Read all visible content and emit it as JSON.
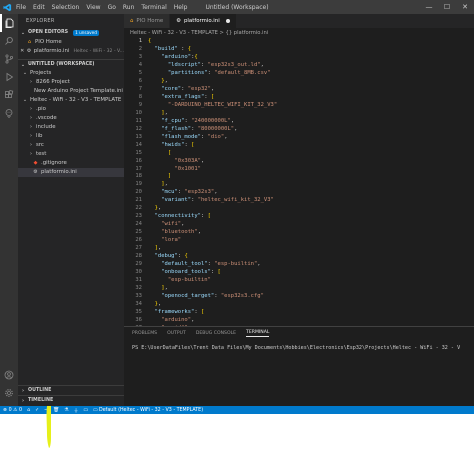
{
  "titlebar": {
    "menu": [
      "File",
      "Edit",
      "Selection",
      "View",
      "Go",
      "Run",
      "Terminal",
      "Help"
    ],
    "window_title": "Untitled (Workspace)",
    "minimize": "—",
    "maximize": "☐",
    "close": "✕"
  },
  "sidebar": {
    "title": "EXPLORER",
    "open_editors": {
      "label": "OPEN EDITORS",
      "badge": "1 unsaved",
      "items": [
        {
          "name": "PIO Home"
        },
        {
          "name": "platformio.ini",
          "detail": "Heltec - WiFi - 32 - V..."
        }
      ]
    },
    "workspace": {
      "label": "UNTITLED (WORKSPACE)",
      "folders": [
        {
          "name": "Projects"
        },
        {
          "name": "8266 Project"
        },
        {
          "name": "New Arduino Project Template.ini"
        }
      ],
      "project": {
        "name": "Heltec - WiFi - 32 - V3 - TEMPLATE",
        "children": [
          ".pio",
          ".vscode",
          "include",
          "lib",
          "src",
          "test",
          ".gitignore",
          "platformio.ini"
        ]
      }
    },
    "outline": "OUTLINE",
    "timeline": "TIMELINE"
  },
  "editor": {
    "tabs": [
      {
        "label": "PIO Home"
      },
      {
        "label": "platformio.ini"
      }
    ],
    "breadcrumb": "Heltec - WiFi - 32 - V3 - TEMPLATE > {} platformio.ini",
    "lines": [
      {
        "n": "1",
        "text": "{"
      },
      {
        "n": "2",
        "text": "  \"build\" : {"
      },
      {
        "n": "3",
        "text": "    \"arduino\":{"
      },
      {
        "n": "4",
        "text": "      \"ldscript\": \"esp32s3_out.ld\","
      },
      {
        "n": "5",
        "text": "      \"partitions\": \"default_8MB.csv\""
      },
      {
        "n": "6",
        "text": "    },"
      },
      {
        "n": "7",
        "text": "    \"core\": \"esp32\","
      },
      {
        "n": "8",
        "text": "    \"extra_flags\": ["
      },
      {
        "n": "9",
        "text": "      \"-DARDUINO_HELTEC_WIFI_KIT_32_V3\""
      },
      {
        "n": "10",
        "text": "    ],"
      },
      {
        "n": "11",
        "text": "    \"f_cpu\": \"240000000L\","
      },
      {
        "n": "12",
        "text": "    \"f_flash\": \"80000000L\","
      },
      {
        "n": "13",
        "text": "    \"flash_mode\": \"dio\","
      },
      {
        "n": "14",
        "text": "    \"hwids\": ["
      },
      {
        "n": "15",
        "text": "      ["
      },
      {
        "n": "16",
        "text": "        \"0x303A\","
      },
      {
        "n": "17",
        "text": "        \"0x1001\""
      },
      {
        "n": "18",
        "text": "      ]"
      },
      {
        "n": "19",
        "text": "    ],"
      },
      {
        "n": "20",
        "text": "    \"mcu\": \"esp32s3\","
      },
      {
        "n": "21",
        "text": "    \"variant\": \"heltec_wifi_kit_32_V3\""
      },
      {
        "n": "22",
        "text": "  },"
      },
      {
        "n": "23",
        "text": "  \"connectivity\": ["
      },
      {
        "n": "24",
        "text": "    \"wifi\","
      },
      {
        "n": "25",
        "text": "    \"bluetooth\","
      },
      {
        "n": "26",
        "text": "    \"lora\""
      },
      {
        "n": "27",
        "text": "  ],"
      },
      {
        "n": "28",
        "text": "  \"debug\": {"
      },
      {
        "n": "29",
        "text": "    \"default_tool\": \"esp-builtin\","
      },
      {
        "n": "30",
        "text": "    \"onboard_tools\": ["
      },
      {
        "n": "31",
        "text": "      \"esp-builtin\""
      },
      {
        "n": "32",
        "text": "    ],"
      },
      {
        "n": "33",
        "text": "    \"openocd_target\": \"esp32s3.cfg\""
      },
      {
        "n": "34",
        "text": "  },"
      },
      {
        "n": "35",
        "text": "  \"frameworks\": ["
      },
      {
        "n": "36",
        "text": "    \"arduino\","
      },
      {
        "n": "37",
        "text": "    \"espidf\""
      }
    ]
  },
  "panel": {
    "tabs": [
      "PROBLEMS",
      "OUTPUT",
      "DEBUG CONSOLE",
      "TERMINAL"
    ],
    "active_tab": "TERMINAL",
    "terminal_line": "PS E:\\UserDataFiles\\Trent Data Files\\My Documents\\Hobbies\\Electronics\\Esp32\\Projects\\Heltec - WiFi - 32 - V"
  },
  "statusbar": {
    "errors": "0",
    "warnings": "0",
    "env": "Default (Heltec - WiFi - 32 - V3 - TEMPLATE)"
  },
  "colors": {
    "accent": "#007acc",
    "highlighter": "#e6f01a"
  }
}
